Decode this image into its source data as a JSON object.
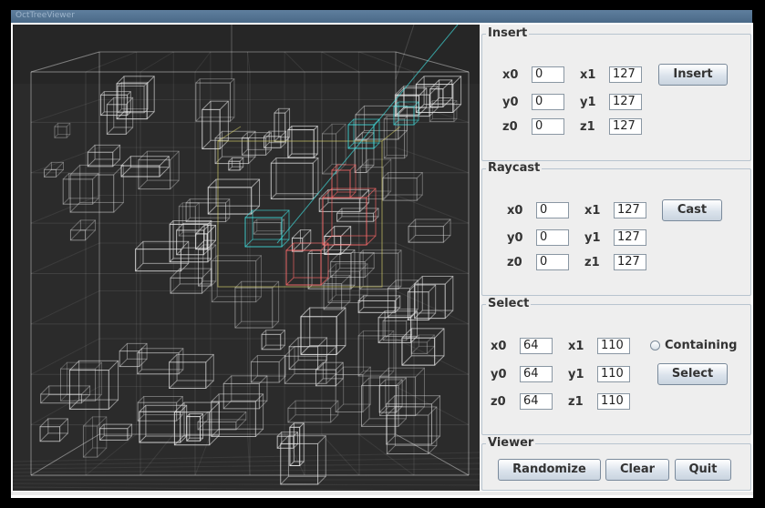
{
  "window": {
    "title": "OctTreeViewer"
  },
  "insert": {
    "title": "Insert",
    "labels": {
      "x0": "x0",
      "y0": "y0",
      "z0": "z0",
      "x1": "x1",
      "y1": "y1",
      "z1": "z1"
    },
    "values": {
      "x0": "0",
      "y0": "0",
      "z0": "0",
      "x1": "127",
      "y1": "127",
      "z1": "127"
    },
    "button": "Insert"
  },
  "raycast": {
    "title": "Raycast",
    "labels": {
      "x0": "x0",
      "y0": "y0",
      "z0": "z0",
      "x1": "x1",
      "y1": "y1",
      "z1": "z1"
    },
    "values": {
      "x0": "0",
      "y0": "0",
      "z0": "0",
      "x1": "127",
      "y1": "127",
      "z1": "127"
    },
    "button": "Cast"
  },
  "select": {
    "title": "Select",
    "labels": {
      "x0": "x0",
      "y0": "y0",
      "z0": "z0",
      "x1": "x1",
      "y1": "y1",
      "z1": "z1"
    },
    "values": {
      "x0": "64",
      "y0": "64",
      "z0": "64",
      "x1": "110",
      "y1": "110",
      "z1": "110"
    },
    "containing_label": "Containing",
    "containing_checked": false,
    "button": "Select"
  },
  "viewer": {
    "title": "Viewer",
    "buttons": {
      "randomize": "Randomize",
      "clear": "Clear",
      "quit": "Quit"
    }
  },
  "colors": {
    "background": "#262626",
    "boxes": "#e8e8e8",
    "ray_hit": "#ff6a6a",
    "ray_path": "#40e0e0",
    "selection": "#e6e070"
  }
}
